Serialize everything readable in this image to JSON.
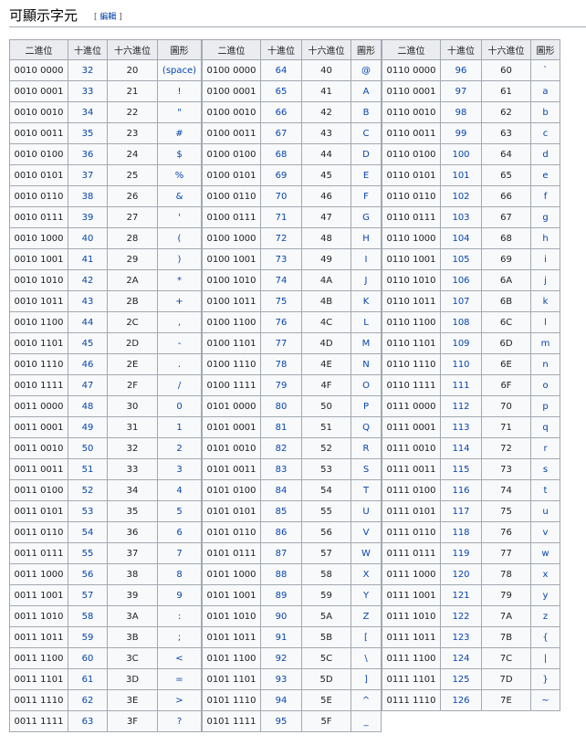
{
  "section": {
    "title": "可顯示字元",
    "edit_open": "[",
    "edit_label": "編輯",
    "edit_close": "]"
  },
  "headers": [
    "二進位",
    "十進位",
    "十六進位",
    "圖形"
  ],
  "tables": [
    {
      "rows": [
        [
          "0010 0000",
          "32",
          "20",
          "(space)"
        ],
        [
          "0010 0001",
          "33",
          "21",
          "!"
        ],
        [
          "0010 0010",
          "34",
          "22",
          "\""
        ],
        [
          "0010 0011",
          "35",
          "23",
          "#"
        ],
        [
          "0010 0100",
          "36",
          "24",
          "$"
        ],
        [
          "0010 0101",
          "37",
          "25",
          "%"
        ],
        [
          "0010 0110",
          "38",
          "26",
          "&"
        ],
        [
          "0010 0111",
          "39",
          "27",
          "'"
        ],
        [
          "0010 1000",
          "40",
          "28",
          "("
        ],
        [
          "0010 1001",
          "41",
          "29",
          ")"
        ],
        [
          "0010 1010",
          "42",
          "2A",
          "*"
        ],
        [
          "0010 1011",
          "43",
          "2B",
          "+"
        ],
        [
          "0010 1100",
          "44",
          "2C",
          ","
        ],
        [
          "0010 1101",
          "45",
          "2D",
          "-"
        ],
        [
          "0010 1110",
          "46",
          "2E",
          "."
        ],
        [
          "0010 1111",
          "47",
          "2F",
          "/"
        ],
        [
          "0011 0000",
          "48",
          "30",
          "0"
        ],
        [
          "0011 0001",
          "49",
          "31",
          "1"
        ],
        [
          "0011 0010",
          "50",
          "32",
          "2"
        ],
        [
          "0011 0011",
          "51",
          "33",
          "3"
        ],
        [
          "0011 0100",
          "52",
          "34",
          "4"
        ],
        [
          "0011 0101",
          "53",
          "35",
          "5"
        ],
        [
          "0011 0110",
          "54",
          "36",
          "6"
        ],
        [
          "0011 0111",
          "55",
          "37",
          "7"
        ],
        [
          "0011 1000",
          "56",
          "38",
          "8"
        ],
        [
          "0011 1001",
          "57",
          "39",
          "9"
        ],
        [
          "0011 1010",
          "58",
          "3A",
          ":"
        ],
        [
          "0011 1011",
          "59",
          "3B",
          ";"
        ],
        [
          "0011 1100",
          "60",
          "3C",
          "<"
        ],
        [
          "0011 1101",
          "61",
          "3D",
          "="
        ],
        [
          "0011 1110",
          "62",
          "3E",
          ">"
        ],
        [
          "0011 1111",
          "63",
          "3F",
          "?"
        ]
      ]
    },
    {
      "rows": [
        [
          "0100 0000",
          "64",
          "40",
          "@"
        ],
        [
          "0100 0001",
          "65",
          "41",
          "A"
        ],
        [
          "0100 0010",
          "66",
          "42",
          "B"
        ],
        [
          "0100 0011",
          "67",
          "43",
          "C"
        ],
        [
          "0100 0100",
          "68",
          "44",
          "D"
        ],
        [
          "0100 0101",
          "69",
          "45",
          "E"
        ],
        [
          "0100 0110",
          "70",
          "46",
          "F"
        ],
        [
          "0100 0111",
          "71",
          "47",
          "G"
        ],
        [
          "0100 1000",
          "72",
          "48",
          "H"
        ],
        [
          "0100 1001",
          "73",
          "49",
          "I"
        ],
        [
          "0100 1010",
          "74",
          "4A",
          "J"
        ],
        [
          "0100 1011",
          "75",
          "4B",
          "K"
        ],
        [
          "0100 1100",
          "76",
          "4C",
          "L"
        ],
        [
          "0100 1101",
          "77",
          "4D",
          "M"
        ],
        [
          "0100 1110",
          "78",
          "4E",
          "N"
        ],
        [
          "0100 1111",
          "79",
          "4F",
          "O"
        ],
        [
          "0101 0000",
          "80",
          "50",
          "P"
        ],
        [
          "0101 0001",
          "81",
          "51",
          "Q"
        ],
        [
          "0101 0010",
          "82",
          "52",
          "R"
        ],
        [
          "0101 0011",
          "83",
          "53",
          "S"
        ],
        [
          "0101 0100",
          "84",
          "54",
          "T"
        ],
        [
          "0101 0101",
          "85",
          "55",
          "U"
        ],
        [
          "0101 0110",
          "86",
          "56",
          "V"
        ],
        [
          "0101 0111",
          "87",
          "57",
          "W"
        ],
        [
          "0101 1000",
          "88",
          "58",
          "X"
        ],
        [
          "0101 1001",
          "89",
          "59",
          "Y"
        ],
        [
          "0101 1010",
          "90",
          "5A",
          "Z"
        ],
        [
          "0101 1011",
          "91",
          "5B",
          "["
        ],
        [
          "0101 1100",
          "92",
          "5C",
          "\\"
        ],
        [
          "0101 1101",
          "93",
          "5D",
          "]"
        ],
        [
          "0101 1110",
          "94",
          "5E",
          "^"
        ],
        [
          "0101 1111",
          "95",
          "5F",
          "_"
        ]
      ]
    },
    {
      "rows": [
        [
          "0110 0000",
          "96",
          "60",
          "`"
        ],
        [
          "0110 0001",
          "97",
          "61",
          "a"
        ],
        [
          "0110 0010",
          "98",
          "62",
          "b"
        ],
        [
          "0110 0011",
          "99",
          "63",
          "c"
        ],
        [
          "0110 0100",
          "100",
          "64",
          "d"
        ],
        [
          "0110 0101",
          "101",
          "65",
          "e"
        ],
        [
          "0110 0110",
          "102",
          "66",
          "f"
        ],
        [
          "0110 0111",
          "103",
          "67",
          "g"
        ],
        [
          "0110 1000",
          "104",
          "68",
          "h"
        ],
        [
          "0110 1001",
          "105",
          "69",
          "i"
        ],
        [
          "0110 1010",
          "106",
          "6A",
          "j"
        ],
        [
          "0110 1011",
          "107",
          "6B",
          "k"
        ],
        [
          "0110 1100",
          "108",
          "6C",
          "l"
        ],
        [
          "0110 1101",
          "109",
          "6D",
          "m"
        ],
        [
          "0110 1110",
          "110",
          "6E",
          "n"
        ],
        [
          "0110 1111",
          "111",
          "6F",
          "o"
        ],
        [
          "0111 0000",
          "112",
          "70",
          "p"
        ],
        [
          "0111 0001",
          "113",
          "71",
          "q"
        ],
        [
          "0111 0010",
          "114",
          "72",
          "r"
        ],
        [
          "0111 0011",
          "115",
          "73",
          "s"
        ],
        [
          "0111 0100",
          "116",
          "74",
          "t"
        ],
        [
          "0111 0101",
          "117",
          "75",
          "u"
        ],
        [
          "0111 0110",
          "118",
          "76",
          "v"
        ],
        [
          "0111 0111",
          "119",
          "77",
          "w"
        ],
        [
          "0111 1000",
          "120",
          "78",
          "x"
        ],
        [
          "0111 1001",
          "121",
          "79",
          "y"
        ],
        [
          "0111 1010",
          "122",
          "7A",
          "z"
        ],
        [
          "0111 1011",
          "123",
          "7B",
          "{"
        ],
        [
          "0111 1100",
          "124",
          "7C",
          "|"
        ],
        [
          "0111 1101",
          "125",
          "7D",
          "}"
        ],
        [
          "0111 1110",
          "126",
          "7E",
          "~"
        ]
      ]
    }
  ]
}
